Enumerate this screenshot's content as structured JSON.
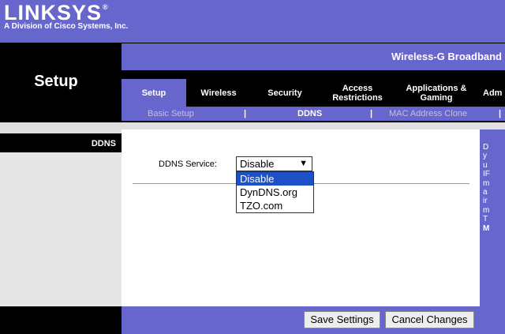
{
  "header": {
    "logo_text": "LINKSYS",
    "logo_mark": "®",
    "sub_text": "A Division of Cisco Systems, Inc.",
    "product_name": "Wireless-G Broadband"
  },
  "section_title": "Setup",
  "tabs": [
    {
      "label": "Setup",
      "active": true
    },
    {
      "label": "Wireless",
      "active": false
    },
    {
      "label": "Security",
      "active": false
    },
    {
      "label": "Access Restrictions",
      "active": false
    },
    {
      "label": "Applications & Gaming",
      "active": false
    },
    {
      "label": "Adm",
      "active": false
    }
  ],
  "subtabs": [
    {
      "label": "Basic Setup",
      "active": false
    },
    {
      "label": "DDNS",
      "active": true
    },
    {
      "label": "MAC Address Clone",
      "active": false
    }
  ],
  "subtab_separator": "|",
  "left_panel": {
    "label": "DDNS"
  },
  "form": {
    "ddns_service_label": "DDNS Service:",
    "selected_value": "Disable",
    "options": [
      "Disable",
      "DynDNS.org",
      "TZO.com"
    ],
    "highlighted_option": "Disable"
  },
  "help_text_fragments": [
    "D",
    "y",
    "u",
    "IF",
    "m",
    "a",
    "ir",
    "m",
    "T",
    "M"
  ],
  "buttons": {
    "save": "Save Settings",
    "cancel": "Cancel Changes"
  },
  "colors": {
    "brand_purple": "#6666cc",
    "highlight_blue": "#1e50c8"
  }
}
